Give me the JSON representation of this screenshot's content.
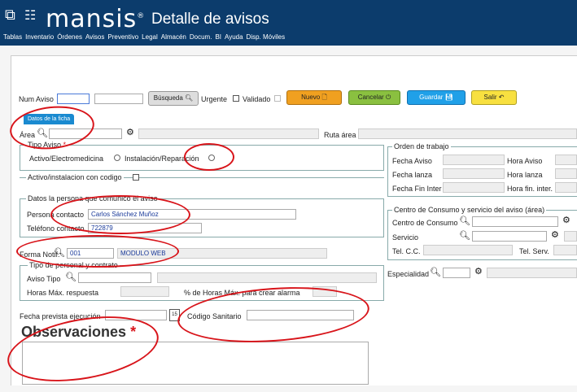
{
  "header": {
    "brand": "mansis",
    "brand_mark": "®",
    "page_title": "Detalle de avisos",
    "menu": [
      "Tablas",
      "Inventario",
      "Órdenes",
      "Avisos",
      "Preventivo",
      "Legal",
      "Almacén",
      "Docum.",
      "BI",
      "Ayuda",
      "Disp. Móviles"
    ]
  },
  "top": {
    "num_aviso_label": "Num Aviso",
    "busqueda_label": "Búsqueda",
    "urgente_label": "Urgente",
    "validado_label": "Validado",
    "nuevo_label": "Nuevo",
    "cancelar_label": "Cancelar",
    "guardar_label": "Guardar",
    "salir_label": "Salir"
  },
  "tab": {
    "label": "Datos de la ficha"
  },
  "area": {
    "label": "Área",
    "ruta_label": "Ruta área"
  },
  "tipo_aviso": {
    "legend": "Tipo Aviso",
    "required": "*",
    "option1": "Activo/Electromedicina",
    "option2": "Instalación/Reparación"
  },
  "activo": {
    "label": "Activo/instalacion con codigo"
  },
  "persona": {
    "legend": "Datos la persona que comunicó el aviso",
    "contacto_label": "Persona contacto",
    "contacto_value": "Carlos Sánchez Muñoz",
    "telefono_label": "Teléfono contacto",
    "telefono_value": "722879"
  },
  "forma": {
    "label": "Forma Notif.",
    "code": "001",
    "value": "MODULO WEB"
  },
  "personal": {
    "legend": "Tipo de personal y contrato",
    "aviso_tipo_label": "Aviso Tipo",
    "horas_label": "Horas Máx. respuesta",
    "pct_label": "% de Horas Máx. para crear alarma"
  },
  "fecha_prev": {
    "label": "Fecha prevista ejecución",
    "cal_text": "15"
  },
  "codigo_sanitario": {
    "label": "Código Sanitario"
  },
  "observaciones": {
    "label": "Observaciones",
    "required": "*"
  },
  "orden": {
    "legend": "Orden de trabajo",
    "fecha_aviso": "Fecha Aviso",
    "hora_aviso": "Hora Aviso",
    "fecha_lanza": "Fecha lanza",
    "hora_lanza": "Hora lanza",
    "fecha_fin": "Fecha Fin Inter",
    "hora_fin": "Hora fin. inter."
  },
  "consumo": {
    "legend": "Centro de Consumo y servicio del aviso (área)",
    "centro_label": "Centro de Consumo",
    "servicio_label": "Servicio",
    "tel_cc_label": "Tel. C.C.",
    "tel_serv_label": "Tel. Serv."
  },
  "especialidad": {
    "label": "Especialidad"
  },
  "colors": {
    "header": "#0c3c6c",
    "tab": "#1a8ad0",
    "annotation": "#d8141a"
  }
}
